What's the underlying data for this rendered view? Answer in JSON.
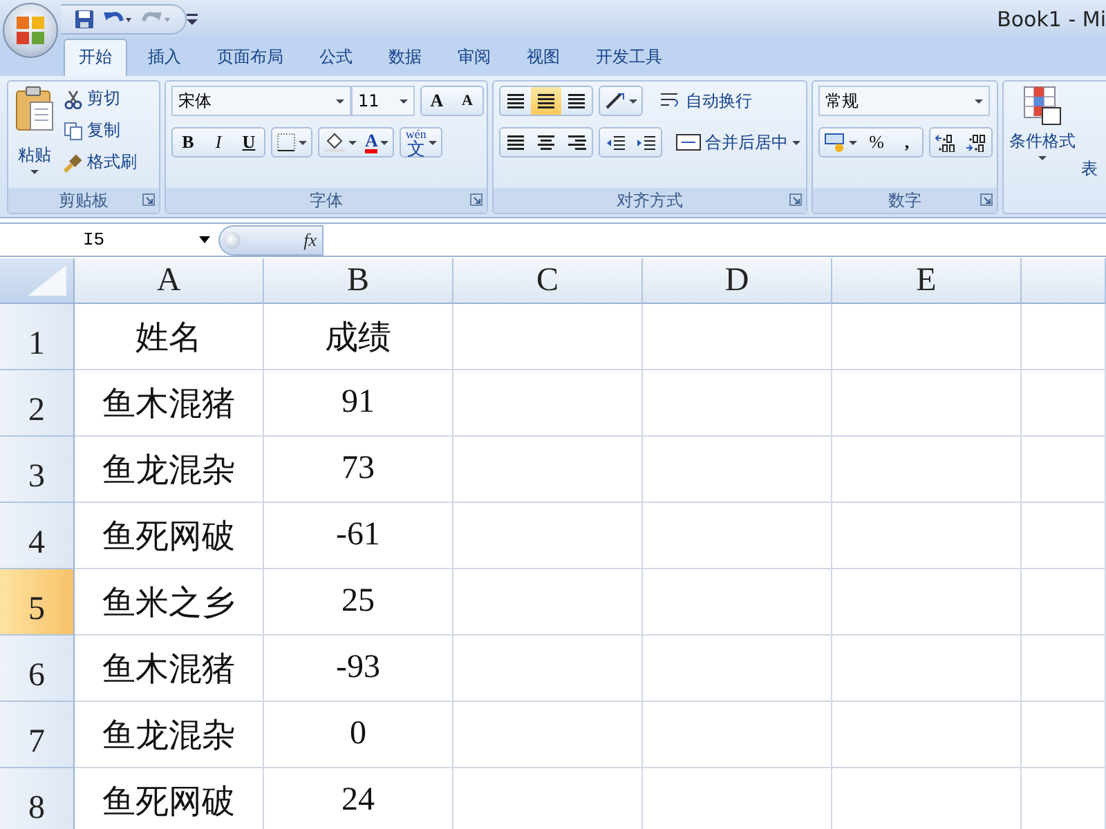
{
  "window": {
    "title": "Book1 - Mi"
  },
  "tabs": [
    {
      "label": "开始",
      "selected": true
    },
    {
      "label": "插入",
      "selected": false
    },
    {
      "label": "页面布局",
      "selected": false
    },
    {
      "label": "公式",
      "selected": false
    },
    {
      "label": "数据",
      "selected": false
    },
    {
      "label": "审阅",
      "selected": false
    },
    {
      "label": "视图",
      "selected": false
    },
    {
      "label": "开发工具",
      "selected": false
    }
  ],
  "ribbon": {
    "clipboard": {
      "paste": "粘贴",
      "cut": "剪切",
      "copy": "复制",
      "format_painter": "格式刷",
      "label": "剪贴板"
    },
    "font": {
      "font_name": "宋体",
      "font_size": "11",
      "grow": "A",
      "shrink": "A",
      "bold": "B",
      "italic": "I",
      "underline": "U",
      "font_color": "A",
      "phonetic_top": "wén",
      "phonetic": "文",
      "label": "字体"
    },
    "alignment": {
      "wrap_text": "自动换行",
      "merge_center": "合并后居中",
      "label": "对齐方式"
    },
    "number": {
      "format": "常规",
      "percent": "%",
      "comma": ",",
      "label": "数字"
    },
    "styles": {
      "conditional_format": "条件格式",
      "table_format": "表"
    }
  },
  "formula_bar": {
    "name_box": "I5",
    "fx": "fx"
  },
  "sheet": {
    "columns": [
      {
        "label": "A",
        "selected": false
      },
      {
        "label": "B",
        "selected": false
      },
      {
        "label": "C",
        "selected": false
      },
      {
        "label": "D",
        "selected": false
      },
      {
        "label": "E",
        "selected": false
      }
    ],
    "rows": [
      {
        "label": "1",
        "selected": false,
        "cells": [
          "姓名",
          "成绩"
        ]
      },
      {
        "label": "2",
        "selected": false,
        "cells": [
          "鱼木混猪",
          "91"
        ]
      },
      {
        "label": "3",
        "selected": false,
        "cells": [
          "鱼龙混杂",
          "73"
        ]
      },
      {
        "label": "4",
        "selected": false,
        "cells": [
          "鱼死网破",
          "-61"
        ]
      },
      {
        "label": "5",
        "selected": true,
        "cells": [
          "鱼米之乡",
          "25"
        ]
      },
      {
        "label": "6",
        "selected": false,
        "cells": [
          "鱼木混猪",
          "-93"
        ]
      },
      {
        "label": "7",
        "selected": false,
        "cells": [
          "鱼龙混杂",
          "0"
        ]
      },
      {
        "label": "8",
        "selected": false,
        "cells": [
          "鱼死网破",
          "24"
        ]
      }
    ]
  }
}
